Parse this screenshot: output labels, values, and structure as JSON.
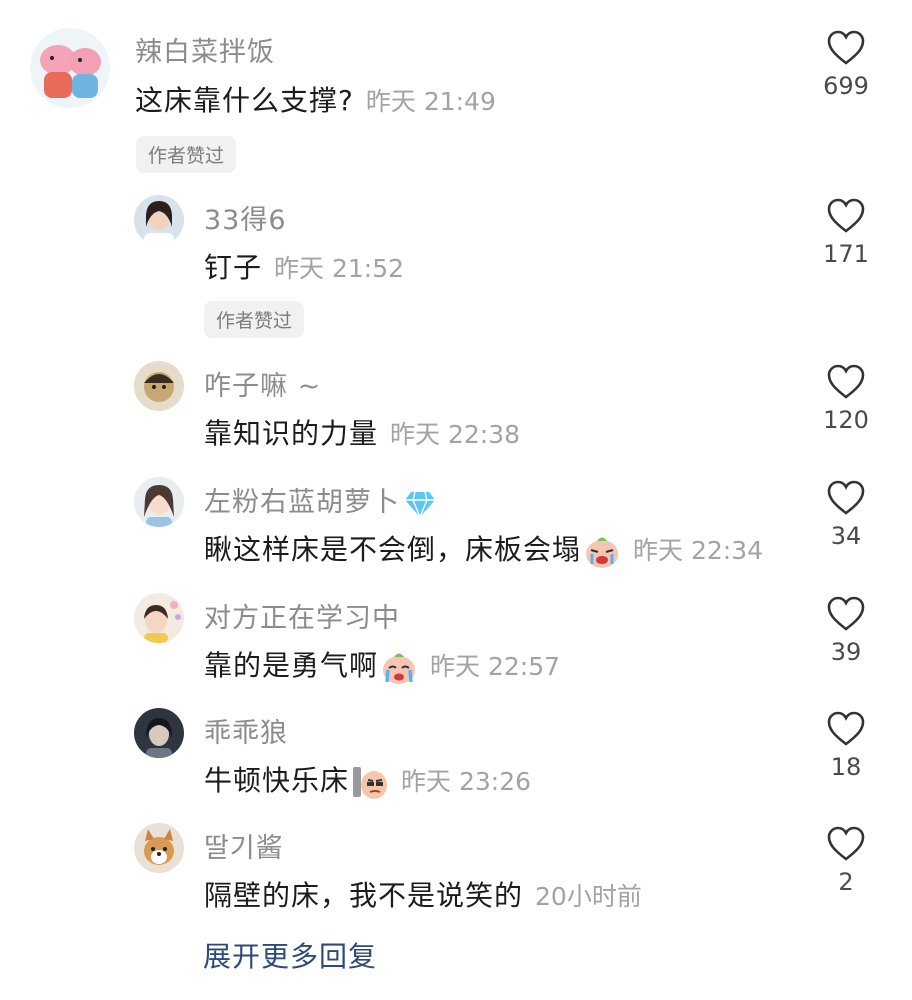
{
  "comments": [
    {
      "name": "辣白菜拌饭",
      "text": "这床靠什么支撑?",
      "time": "昨天 21:49",
      "likes": "699",
      "badge": "作者赞过"
    },
    {
      "name": "33得6",
      "text": "钉子",
      "time": "昨天 21:52",
      "likes": "171",
      "badge": "作者赞过"
    },
    {
      "name": "咋子嘛 ~",
      "text": "靠知识的力量",
      "time": "昨天 22:38",
      "likes": "120"
    },
    {
      "name": "左粉右蓝胡萝卜",
      "text": "瞅这样床是不会倒，床板会塌",
      "time": "昨天 22:34",
      "likes": "34",
      "name_icon": "diamond-icon",
      "emoji": "crying-face-emoji"
    },
    {
      "name": "对方正在学习中",
      "text": "靠的是勇气啊",
      "time": "昨天 22:57",
      "likes": "39",
      "emoji": "crying-face-emoji"
    },
    {
      "name": "乖乖狼",
      "text": "牛顿快乐床",
      "time": "昨天 23:26",
      "likes": "18",
      "emoji": "smirk-face-emoji"
    },
    {
      "name": "딸기酱",
      "text": "隔壁的床，我不是说笑的",
      "time": "20小时前",
      "likes": "2"
    }
  ],
  "expand_label": "展开更多回复",
  "icons": {
    "like": "heart-outline-icon"
  },
  "colors": {
    "name": "#8c8c8c",
    "text": "#1c1c1c",
    "time": "#a3a3a3",
    "link": "#2d4a7a"
  }
}
